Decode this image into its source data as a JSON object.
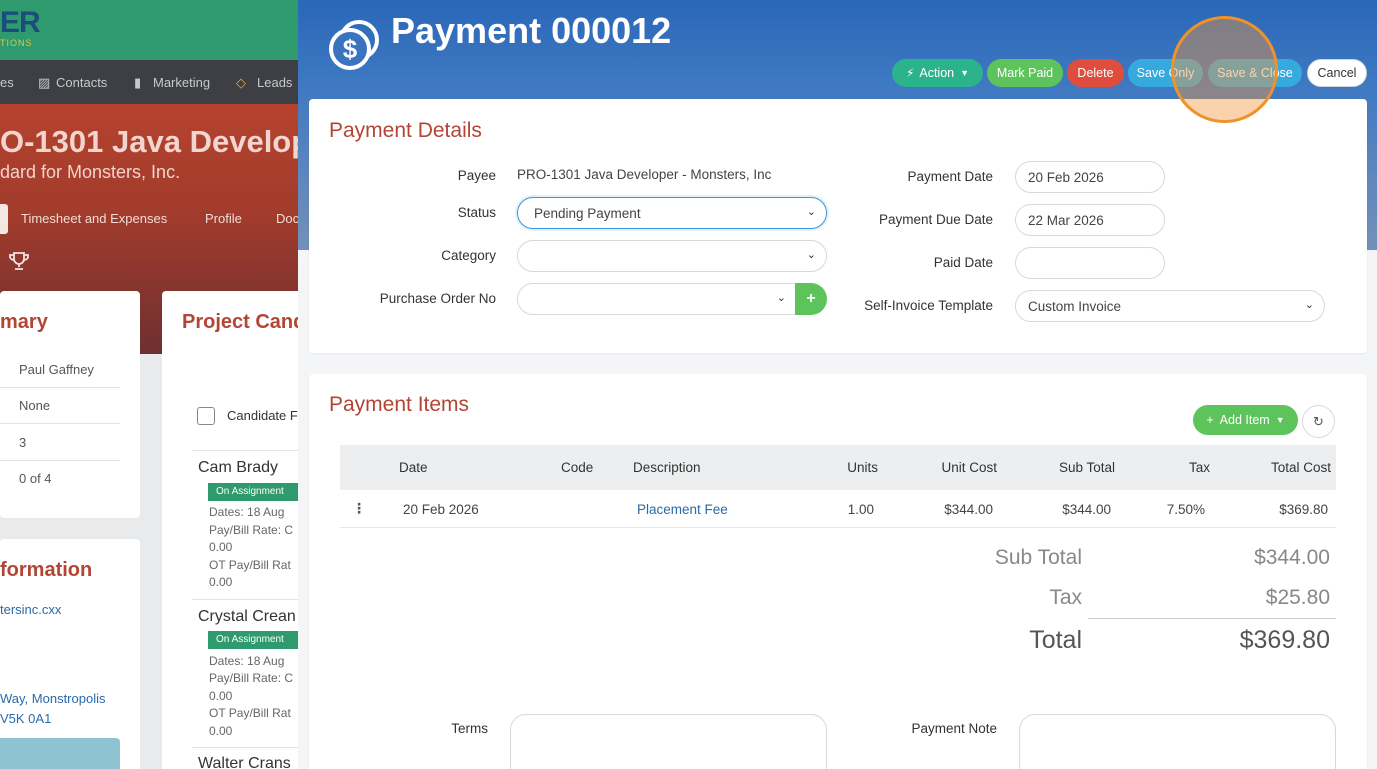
{
  "background": {
    "logo": "ER",
    "logo_sub": "TIONS",
    "nav": [
      "es",
      "Contacts",
      "Marketing",
      "Leads"
    ],
    "title": "O-1301 Java Develop",
    "subtitle": "dard for Monsters, Inc.",
    "tabs": [
      "Timesheet and Expenses",
      "Profile",
      "Doc"
    ],
    "summary_title": "mary",
    "summary_rows": [
      "Paul Gaffney",
      "None",
      "3",
      "0 of 4"
    ],
    "info_title": "formation",
    "info_link": "tersinc.cxx",
    "address_1": "Way, Monstropolis",
    "address_2": "V5K 0A1",
    "candidates_title": "Project Cand",
    "candidate_checkbox_label": "Candidate F",
    "candidates": [
      {
        "name": "Cam Brady",
        "badge": "On Assignment",
        "dates": "Dates: 18 Aug",
        "rate": "Pay/Bill Rate: C",
        "rate_val": "0.00",
        "ot": "OT Pay/Bill Rat",
        "ot_val": "0.00"
      },
      {
        "name": "Crystal Crean",
        "badge": "On Assignment",
        "dates": "Dates: 18 Aug",
        "rate": "Pay/Bill Rate: C",
        "rate_val": "0.00",
        "ot": "OT Pay/Bill Rat",
        "ot_val": "0.00"
      },
      {
        "name": "Walter Crans"
      }
    ]
  },
  "modal": {
    "title": "Payment 000012",
    "toolbar": {
      "action": "Action",
      "mark_paid": "Mark Paid",
      "delete": "Delete",
      "save_only": "Save Only",
      "save_close": "Save & Close",
      "cancel": "Cancel"
    },
    "details": {
      "title": "Payment Details",
      "payee_label": "Payee",
      "payee_value": "PRO-1301 Java Developer - Monsters, Inc",
      "status_label": "Status",
      "status_value": "Pending Payment",
      "category_label": "Category",
      "category_value": "",
      "po_label": "Purchase Order No",
      "po_value": "",
      "payment_date_label": "Payment Date",
      "payment_date_value": "20 Feb 2026",
      "due_date_label": "Payment Due Date",
      "due_date_value": "22 Mar 2026",
      "paid_date_label": "Paid Date",
      "paid_date_value": "",
      "template_label": "Self-Invoice Template",
      "template_value": "Custom Invoice"
    },
    "items": {
      "title": "Payment Items",
      "add_item": "Add Item",
      "columns": [
        "Date",
        "Code",
        "Description",
        "Units",
        "Unit Cost",
        "Sub Total",
        "Tax",
        "Total Cost"
      ],
      "rows": [
        {
          "date": "20 Feb 2026",
          "code": "",
          "description": "Placement Fee",
          "units": "1.00",
          "unit_cost": "$344.00",
          "sub_total": "$344.00",
          "tax": "7.50%",
          "total_cost": "$369.80"
        }
      ],
      "sub_total_label": "Sub Total",
      "sub_total_value": "$344.00",
      "tax_label": "Tax",
      "tax_value": "$25.80",
      "total_label": "Total",
      "total_value": "$369.80",
      "terms_label": "Terms",
      "payment_note_label": "Payment Note"
    }
  }
}
